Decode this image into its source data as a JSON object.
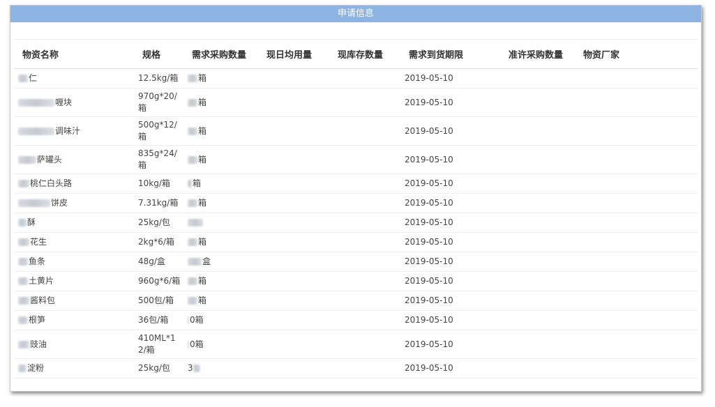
{
  "panel": {
    "title": "申请信息"
  },
  "table": {
    "columns": [
      "物资名称",
      "规格",
      "需求采购数量",
      "现日均用量",
      "现库存数量",
      "需求到货期限",
      "准许采购数量",
      "物资厂家"
    ],
    "rows": [
      {
        "name_suffix": "仁",
        "spec": "12.5kg/箱",
        "qty_suffix": "箱",
        "daily": "",
        "stock": "",
        "due": "2019-05-10",
        "approved": "",
        "vendor": ""
      },
      {
        "name_suffix": "喱块",
        "spec": "970g*20/箱",
        "qty_suffix": "箱",
        "daily": "",
        "stock": "",
        "due": "2019-05-10",
        "approved": "",
        "vendor": ""
      },
      {
        "name_suffix": "调味汁",
        "spec": "500g*12/箱",
        "qty_suffix": "箱",
        "daily": "",
        "stock": "",
        "due": "2019-05-10",
        "approved": "",
        "vendor": ""
      },
      {
        "name_suffix": "萨罐头",
        "spec": "835g*24/箱",
        "qty_suffix": "箱",
        "daily": "",
        "stock": "",
        "due": "2019-05-10",
        "approved": "",
        "vendor": ""
      },
      {
        "name_suffix": "桃仁白头路",
        "spec": "10kg/箱",
        "qty_suffix": "箱",
        "daily": "",
        "stock": "",
        "due": "2019-05-10",
        "approved": "",
        "vendor": ""
      },
      {
        "name_suffix": "饼皮",
        "spec": "7.31kg/箱",
        "qty_suffix": "箱",
        "daily": "",
        "stock": "",
        "due": "2019-05-10",
        "approved": "",
        "vendor": ""
      },
      {
        "name_suffix": "酥",
        "spec": "25kg/包",
        "qty_suffix": "",
        "daily": "",
        "stock": "",
        "due": "2019-05-10",
        "approved": "",
        "vendor": ""
      },
      {
        "name_suffix": "花生",
        "spec": "2kg*6/箱",
        "qty_suffix": "箱",
        "daily": "",
        "stock": "",
        "due": "2019-05-10",
        "approved": "",
        "vendor": ""
      },
      {
        "name_suffix": "鱼条",
        "spec": "48g/盒",
        "qty_suffix": "盒",
        "daily": "",
        "stock": "",
        "due": "2019-05-10",
        "approved": "",
        "vendor": ""
      },
      {
        "name_suffix": "土黄片",
        "spec": "960g*6/箱",
        "qty_suffix": "箱",
        "daily": "",
        "stock": "",
        "due": "2019-05-10",
        "approved": "",
        "vendor": ""
      },
      {
        "name_suffix": "酱料包",
        "spec": "500包/箱",
        "qty_suffix": "箱",
        "daily": "",
        "stock": "",
        "due": "2019-05-10",
        "approved": "",
        "vendor": ""
      },
      {
        "name_suffix": "根笋",
        "spec": "36包/箱",
        "qty_suffix": "0箱",
        "daily": "",
        "stock": "",
        "due": "2019-05-10",
        "approved": "",
        "vendor": ""
      },
      {
        "name_suffix": "豉油",
        "spec": "410ML*12/箱",
        "qty_suffix": "0箱",
        "daily": "",
        "stock": "",
        "due": "2019-05-10",
        "approved": "",
        "vendor": ""
      },
      {
        "name_suffix": "淀粉",
        "spec": "25kg/包",
        "qty_suffix": "",
        "daily": "",
        "stock": "",
        "due": "2019-05-10",
        "approved": "",
        "vendor": ""
      }
    ],
    "qty_prefix_for_last": "3"
  }
}
